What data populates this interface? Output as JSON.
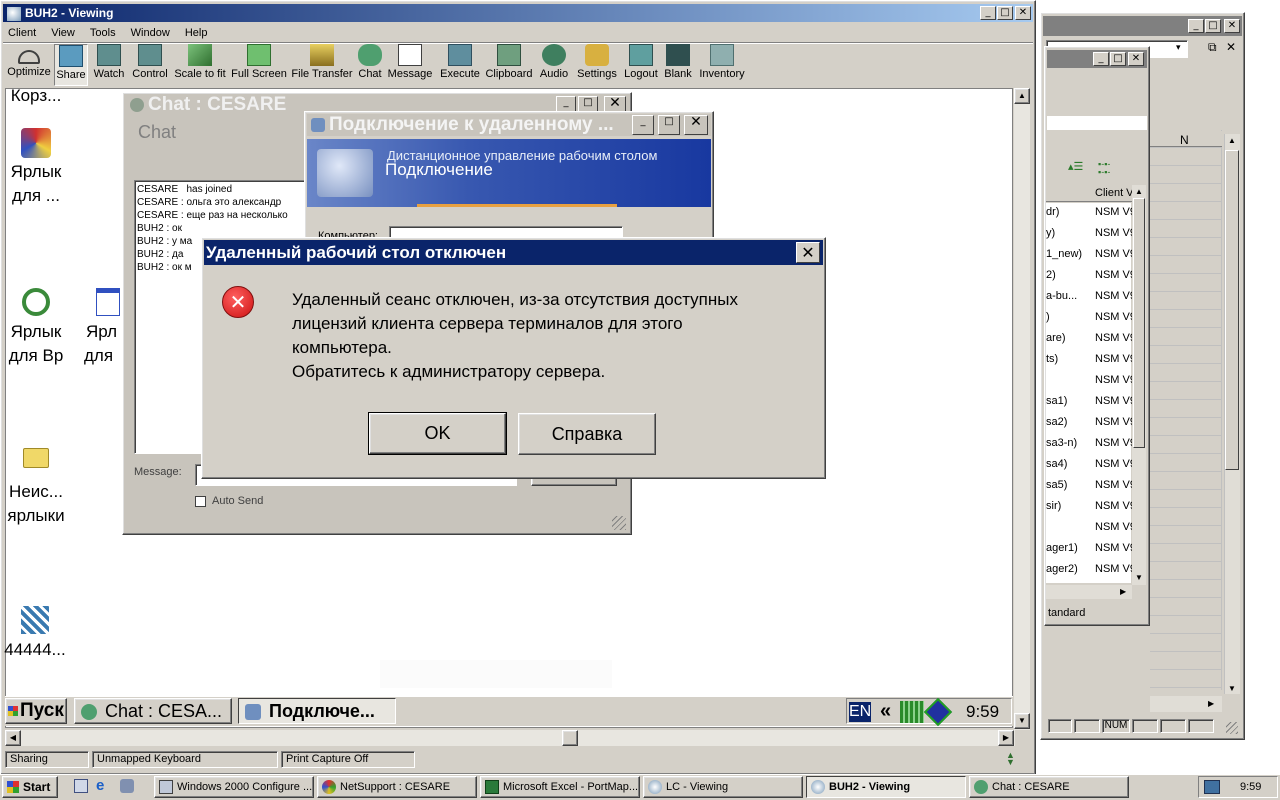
{
  "main_window": {
    "title": "BUH2 - Viewing",
    "menu": [
      "Client",
      "View",
      "Tools",
      "Window",
      "Help"
    ],
    "toolbar": [
      "Optimize",
      "Share",
      "Watch",
      "Control",
      "Scale to fit",
      "Full Screen",
      "File Transfer",
      "Chat",
      "Message",
      "Execute",
      "Clipboard",
      "Audio",
      "Settings",
      "Logout",
      "Blank",
      "Inventory"
    ],
    "status": {
      "sharing": "Sharing",
      "keyboard": "Unmapped Keyboard",
      "capture": "Print Capture Off"
    }
  },
  "remote_desktop": {
    "icons": [
      {
        "label1": "Корз...",
        "label2": ""
      },
      {
        "label1": "Ярлык",
        "label2": "для ..."
      },
      {
        "label1": "Ярлык",
        "label2": "для Вр"
      },
      {
        "label1": "Ярл",
        "label2": "для"
      },
      {
        "label1": "Неис...",
        "label2": "ярлыки"
      },
      {
        "label1": "44444...",
        "label2": ""
      }
    ],
    "taskbar": {
      "start": "Пуск",
      "items": [
        "Chat : CESA...",
        "Подключе..."
      ],
      "lang": "EN",
      "chevron": "«",
      "clock": "9:59"
    }
  },
  "chat_window": {
    "title": "Chat : CESARE",
    "heading": "Chat",
    "messages": [
      "CESARE   has joined",
      "CESARE : ольга это александр",
      "CESARE : еще раз на несколько",
      "BUH2 : ок",
      "BUH2 : у ма",
      "BUH2 : да",
      "BUH2 : ок м"
    ],
    "message_label": "Message:",
    "send_label": "Send",
    "auto_send": "Auto Send"
  },
  "rdp_window": {
    "title": "Подключение к удаленному ...",
    "banner_line1": "Дистанционное управление рабочим столом",
    "banner_line2": "Подключение",
    "computer_label": "Компьютер:"
  },
  "dialog": {
    "title": "Удаленный рабочий стол отключен",
    "message_lines": [
      "Удаленный сеанс отключен, из-за отсутствия доступных",
      "лицензий клиента сервера терминалов для этого",
      "компьютера.",
      "Обратитесь к администратору сервера."
    ],
    "ok": "OK",
    "help": "Справка"
  },
  "right_window": {
    "column_n": "N",
    "column_client": "Client V",
    "rows": [
      {
        "name": "dr)",
        "client": "NSM V9"
      },
      {
        "name": "y)",
        "client": "NSM V9"
      },
      {
        "name": "1_new)",
        "client": "NSM V9"
      },
      {
        "name": "2)",
        "client": "NSM V9"
      },
      {
        "name": "a-bu...",
        "client": "NSM V9"
      },
      {
        "name": ")",
        "client": "NSM V9"
      },
      {
        "name": "are)",
        "client": "NSM V9"
      },
      {
        "name": "ts)",
        "client": "NSM V9"
      },
      {
        "name": "",
        "client": "NSM V9"
      },
      {
        "name": "sa1)",
        "client": "NSM V9"
      },
      {
        "name": "sa2)",
        "client": "NSM V9"
      },
      {
        "name": "sa3-n)",
        "client": "NSM V9"
      },
      {
        "name": "sa4)",
        "client": "NSM V9"
      },
      {
        "name": "sa5)",
        "client": "NSM V9"
      },
      {
        "name": "sir)",
        "client": "NSM V9"
      },
      {
        "name": "",
        "client": "NSM V9"
      },
      {
        "name": "ager1)",
        "client": "NSM V9"
      },
      {
        "name": "ager2)",
        "client": "NSM V9"
      }
    ],
    "status_standard": "tandard",
    "num": "NUM"
  },
  "host_taskbar": {
    "start": "Start",
    "items": [
      "Windows 2000 Configure ...",
      "NetSupport : CESARE",
      "Microsoft Excel - PortMap...",
      "LC - Viewing",
      "BUH2 - Viewing",
      "Chat : CESARE"
    ],
    "clock": "9:59"
  },
  "colors": {
    "title_active": "#0a246a",
    "title_gradient": "#a6caf0",
    "desktop_bg": "#ffffff",
    "face": "#d4d0c8",
    "error_red": "#cc1111"
  }
}
